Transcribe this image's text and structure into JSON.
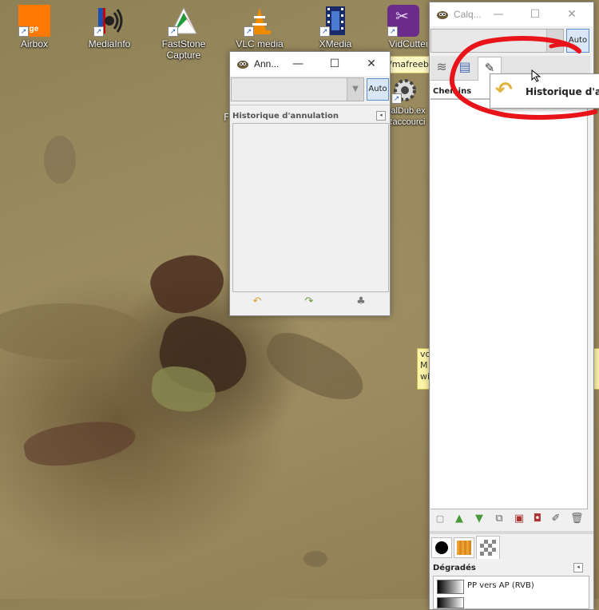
{
  "desktop": {
    "icons": [
      {
        "label": "Airbox",
        "logo_text": "ange",
        "color": "#ff7900"
      },
      {
        "label": "MediaInfo"
      },
      {
        "label": "FastStone Capture"
      },
      {
        "label": "VLC media"
      },
      {
        "label": "XMedia Recode"
      },
      {
        "label": "VidCutter"
      },
      {
        "label": "ualDub.ex Raccourci"
      }
    ],
    "partial_text": {
      "url_fragment": "/mafreeb",
      "f_char": "F",
      "note_line1": "vo",
      "note_line2": "M",
      "note_line3": "wi"
    }
  },
  "undo_window": {
    "title": "Ann...",
    "auto_label": "Auto",
    "panel_title": "Historique d'annulation",
    "buttons": [
      "undo-icon",
      "redo-icon",
      "clear-history-icon"
    ]
  },
  "layers_window": {
    "title": "Calq...",
    "auto_label": "Auto",
    "tabs": [
      "layers-icon",
      "channels-icon",
      "paths-icon"
    ],
    "panel_title": "Chemins",
    "tooltip_text": "Historique d'ann",
    "bottom_tabs": [
      "brush-icon",
      "pattern-icon",
      "gradient-icon"
    ],
    "gradients_title": "Dégradés",
    "gradient_item": "PP vers AP (RVB)"
  },
  "annotation": {
    "color": "#e8141a"
  }
}
